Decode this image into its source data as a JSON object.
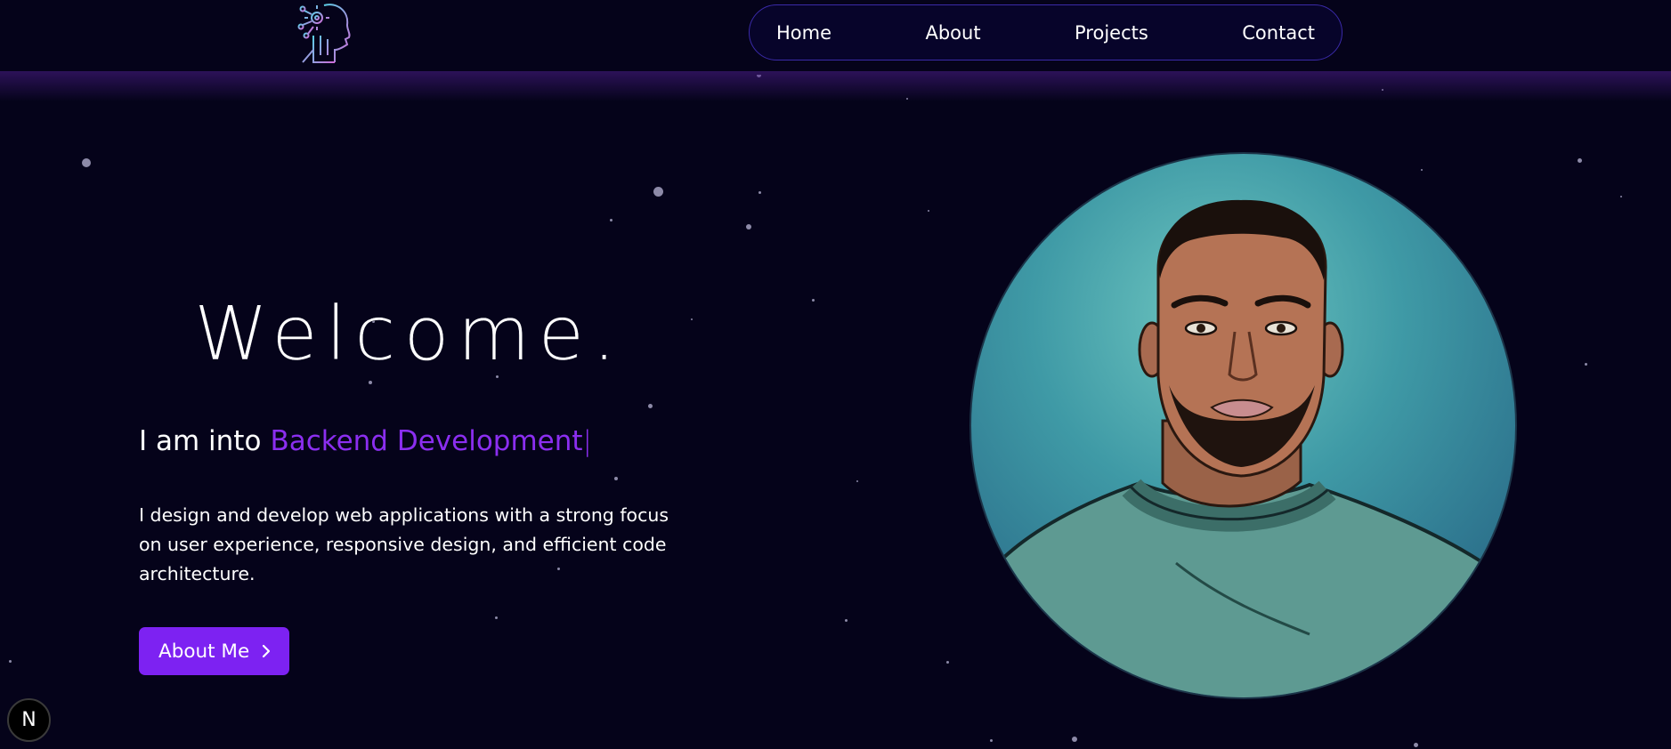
{
  "nav": {
    "items": [
      {
        "label": "Home"
      },
      {
        "label": "About"
      },
      {
        "label": "Projects"
      },
      {
        "label": "Contact"
      }
    ]
  },
  "hero": {
    "welcome": "Welcome.",
    "intro_prefix": "I am into",
    "intro_role": "Backend Development",
    "caret": "|",
    "description": "I design and develop web applications with a strong focus on user experience, responsive design, and efficient code architecture.",
    "about_button": "About Me"
  },
  "badge": {
    "letter": "N"
  },
  "colors": {
    "background": "#05031a",
    "accent": "#7d22f2",
    "role_text": "#8b2ef0",
    "nav_border": "#3a2aa8"
  },
  "icons": [
    "logo-icon",
    "chevron-right-icon",
    "next-logo-icon"
  ]
}
